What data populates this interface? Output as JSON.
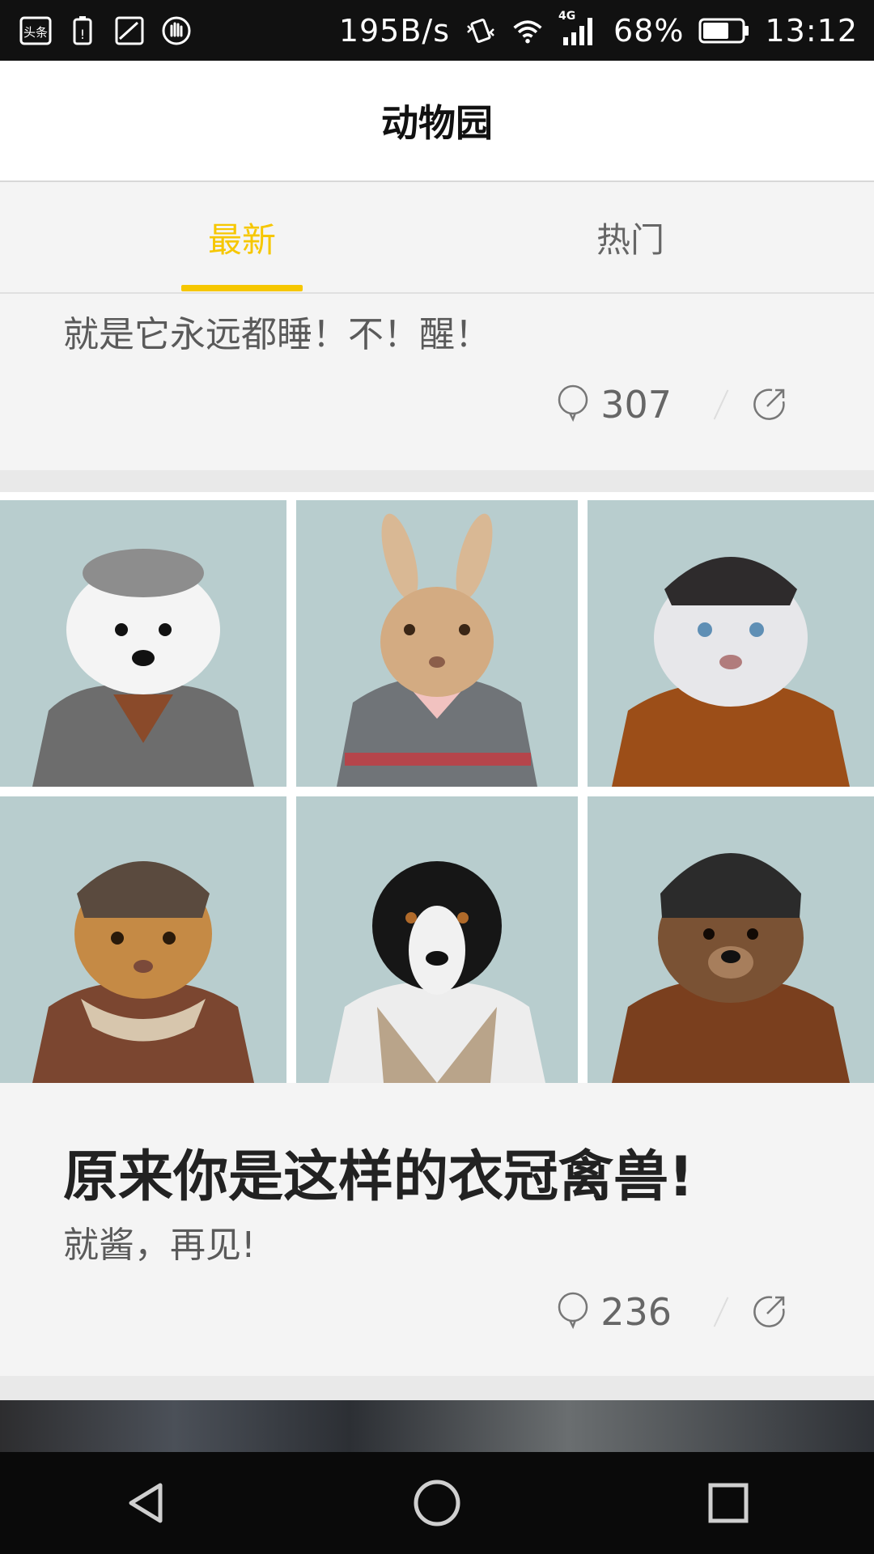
{
  "status_bar": {
    "net_speed": "195B/s",
    "network_type": "4G",
    "battery_percent": "68%",
    "battery_level": 0.68,
    "time": "13:12",
    "left_icons": [
      "toutiao-app-icon",
      "battery-warning-icon",
      "image-icon",
      "hand-icon"
    ]
  },
  "header": {
    "title": "动物园"
  },
  "tabs": [
    {
      "label": "最新",
      "active": true
    },
    {
      "label": "热门",
      "active": false
    }
  ],
  "colors": {
    "accent": "#f6c700",
    "text_primary": "#222222",
    "text_secondary": "#5a5a5a"
  },
  "feed": [
    {
      "subtitle": "就是它永远都睡！不！醒！",
      "comment_count": "307"
    },
    {
      "images": [
        "dog-in-tweed-coat-and-cap",
        "rabbit-in-cardigan",
        "white-tiger-in-cap",
        "leopard-cub-in-aviator-hat",
        "border-collie-in-plaid-vest",
        "bear-in-knit-beanie"
      ],
      "title": "原来你是这样的衣冠禽兽!",
      "subtitle": "就酱，再见!",
      "comment_count": "236"
    }
  ],
  "nav": [
    "back-icon",
    "home-icon",
    "recents-icon"
  ]
}
